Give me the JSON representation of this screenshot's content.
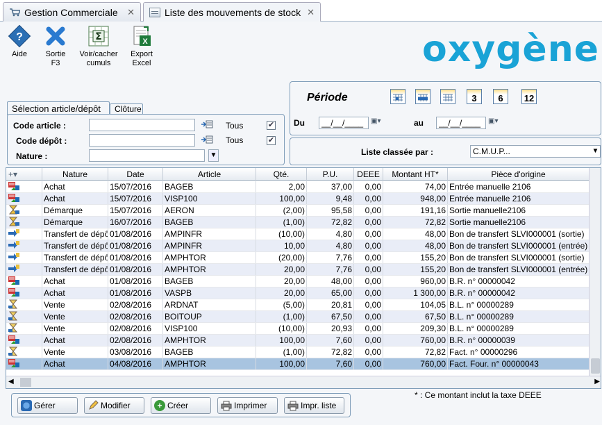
{
  "tabs": [
    {
      "label": "Gestion Commerciale",
      "close": "✕"
    },
    {
      "label": "Liste des mouvements de stock",
      "close": "✕"
    }
  ],
  "toolbar": [
    {
      "label": "Aide",
      "icon": "help-icon"
    },
    {
      "label": "Sortie\nF3",
      "icon": "close-x-icon"
    },
    {
      "label": "Voir/cacher\ncumuls",
      "icon": "sigma-icon"
    },
    {
      "label": "Export\nExcel",
      "icon": "excel-icon"
    }
  ],
  "logo": "oxygène",
  "selection": {
    "tab1": "Sélection article/dépôt",
    "tab2": "Clôture",
    "code_article_label": "Code article :",
    "code_depot_label": "Code dépôt :",
    "nature_label": "Nature :",
    "tous": "Tous",
    "code_article_value": "",
    "code_depot_value": "",
    "nature_value": ""
  },
  "periode": {
    "title": "Période",
    "du_label": "Du",
    "au_label": "au",
    "du_value": "__/__/____",
    "au_value": "__/__/____",
    "buttons": [
      "",
      "",
      "",
      "3",
      "6",
      "12"
    ]
  },
  "classement": {
    "label": "Liste classée par :",
    "value": "C.M.U.P..."
  },
  "grid": {
    "columns": [
      "Nature",
      "Date",
      "Article",
      "Qté.",
      "P.U.",
      "DEEE",
      "Montant HT*",
      "Pièce d'origine"
    ],
    "rows": [
      [
        "Achat",
        "15/07/2016",
        "BAGEB",
        "2,00",
        "37,00",
        "0,00",
        "74,00",
        "Entrée manuelle 2106"
      ],
      [
        "Achat",
        "15/07/2016",
        "VISP100",
        "100,00",
        "9,48",
        "0,00",
        "948,00",
        "Entrée manuelle 2106"
      ],
      [
        "Démarque",
        "15/07/2016",
        "AERON",
        "(2,00)",
        "95,58",
        "0,00",
        "191,16",
        "Sortie manuelle2106"
      ],
      [
        "Démarque",
        "16/07/2016",
        "BAGEB",
        "(1,00)",
        "72,82",
        "0,00",
        "72,82",
        "Sortie manuelle2106"
      ],
      [
        "Transfert de dépôt",
        "01/08/2016",
        "AMPINFR",
        "(10,00)",
        "4,80",
        "0,00",
        "48,00",
        "Bon de transfert SLVI000001 (sortie)"
      ],
      [
        "Transfert de dépôt",
        "01/08/2016",
        "AMPINFR",
        "10,00",
        "4,80",
        "0,00",
        "48,00",
        "Bon de transfert SLVI000001 (entrée)"
      ],
      [
        "Transfert de dépôt",
        "01/08/2016",
        "AMPHTOR",
        "(20,00)",
        "7,76",
        "0,00",
        "155,20",
        "Bon de transfert SLVI000001 (sortie)"
      ],
      [
        "Transfert de dépôt",
        "01/08/2016",
        "AMPHTOR",
        "20,00",
        "7,76",
        "0,00",
        "155,20",
        "Bon de transfert SLVI000001 (entrée)"
      ],
      [
        "Achat",
        "01/08/2016",
        "BAGEB",
        "20,00",
        "48,00",
        "0,00",
        "960,00",
        "B.R. n° 00000042"
      ],
      [
        "Achat",
        "01/08/2016",
        "VASPB",
        "20,00",
        "65,00",
        "0,00",
        "1 300,00",
        "B.R. n° 00000042"
      ],
      [
        "Vente",
        "02/08/2016",
        "ARDNAT",
        "(5,00)",
        "20,81",
        "0,00",
        "104,05",
        "B.L. n° 00000289"
      ],
      [
        "Vente",
        "02/08/2016",
        "BOITOUP",
        "(1,00)",
        "67,50",
        "0,00",
        "67,50",
        "B.L. n° 00000289"
      ],
      [
        "Vente",
        "02/08/2016",
        "VISP100",
        "(10,00)",
        "20,93",
        "0,00",
        "209,30",
        "B.L. n° 00000289"
      ],
      [
        "Achat",
        "02/08/2016",
        "AMPHTOR",
        "100,00",
        "7,60",
        "0,00",
        "760,00",
        "B.R. n° 00000039"
      ],
      [
        "Vente",
        "03/08/2016",
        "BAGEB",
        "(1,00)",
        "72,82",
        "0,00",
        "72,82",
        "Fact. n° 00000296"
      ],
      [
        "Achat",
        "04/08/2016",
        "AMPHTOR",
        "100,00",
        "7,60",
        "0,00",
        "760,00",
        "Fact. Four. n° 00000043"
      ]
    ],
    "row_icons": [
      "achat",
      "achat",
      "demarque",
      "demarque",
      "transfert",
      "transfert",
      "transfert",
      "transfert",
      "achat",
      "achat",
      "vente",
      "vente",
      "vente",
      "achat",
      "vente",
      "achat"
    ]
  },
  "buttons": [
    "Gérer",
    "Modifier",
    "Créer",
    "Imprimer",
    "Impr. liste"
  ],
  "footnote": "* : Ce montant inclut la taxe DEEE",
  "colors": {
    "accent": "#1aa3d6",
    "selected_row": "#a8c4e0",
    "alt_row": "#e9edf7"
  }
}
